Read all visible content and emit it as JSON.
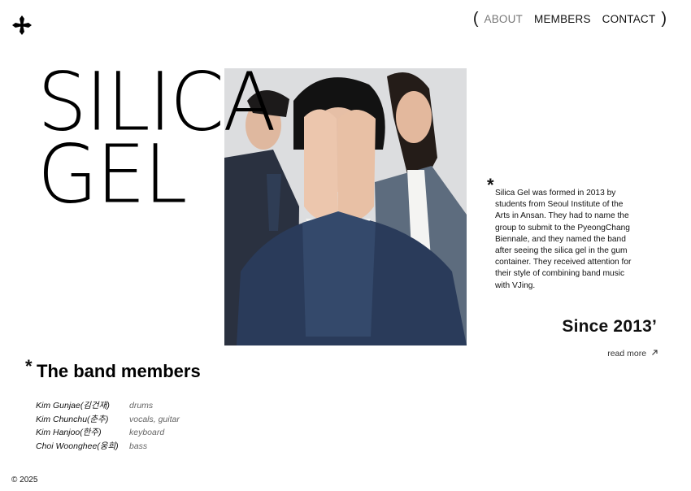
{
  "nav": {
    "open_paren": "(",
    "close_paren": ")",
    "items": [
      {
        "label": "ABOUT"
      },
      {
        "label": "MEMBERS"
      },
      {
        "label": "CONTACT"
      }
    ]
  },
  "logo": {
    "icon": "cross-pattee-icon"
  },
  "hero": {
    "title_line1": "SILICA",
    "title_line2": "GEL"
  },
  "about": {
    "asterisk": "*",
    "text": "Silica Gel was formed in 2013 by students from Seoul Institute of the Arts in Ansan. They had to name the group to submit to the PyeongChang Biennale, and they named the band after seeing the silica gel in the gum container. They received attention for their style of combining band music with VJing.",
    "since": "Since 2013’",
    "read_more": "read more",
    "read_more_icon": "arrow-up-right-icon"
  },
  "members": {
    "asterisk": "*",
    "title": "The band members",
    "list": [
      {
        "name": "Kim Gunjae(김건재)",
        "role": "drums"
      },
      {
        "name": "Kim Chunchu(춘추)",
        "role": "vocals, guitar"
      },
      {
        "name": "Kim Hanjoo(한주)",
        "role": "keyboard"
      },
      {
        "name": "Choi Woonghee(웅희)",
        "role": "bass"
      }
    ]
  },
  "footer": {
    "copyright": "© 2025"
  }
}
